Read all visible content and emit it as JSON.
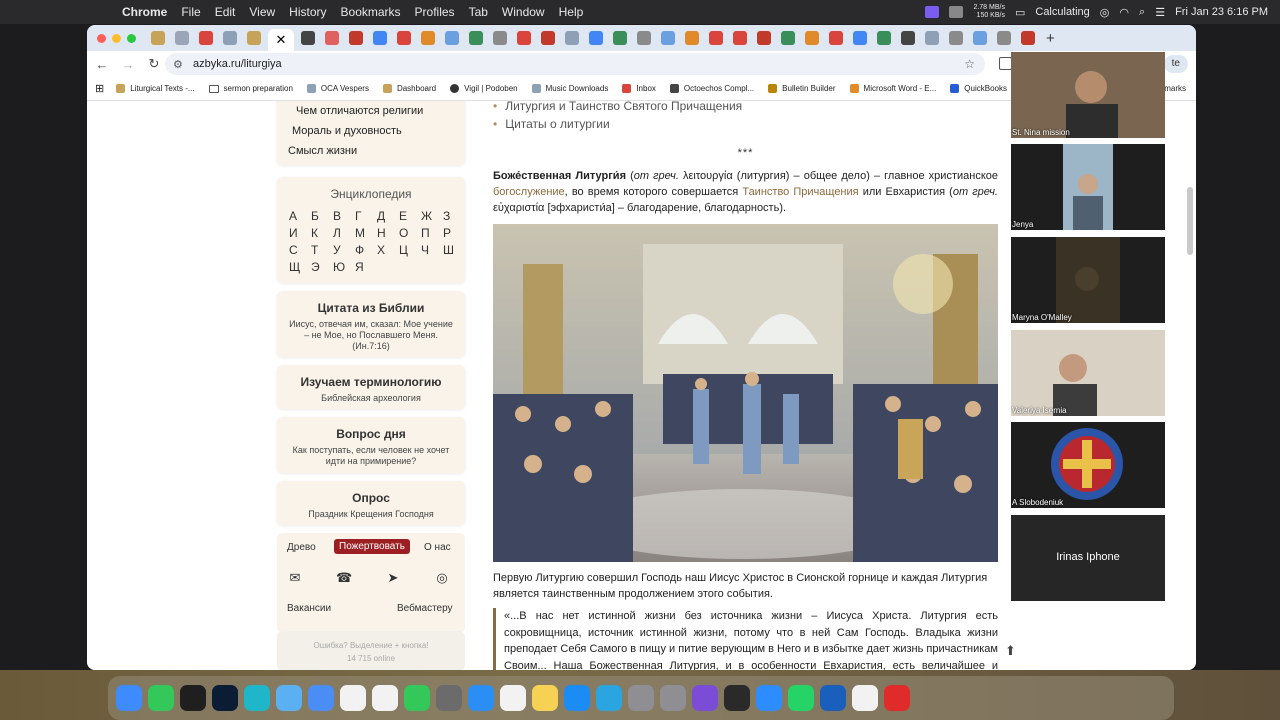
{
  "menubar": {
    "app": "Chrome",
    "items": [
      "File",
      "Edit",
      "View",
      "History",
      "Bookmarks",
      "Profiles",
      "Tab",
      "Window",
      "Help"
    ],
    "net_up": "2.78 MB/s",
    "net_down": "150 KB/s",
    "battery_status": "Calculating",
    "clock": "Fri Jan 23  6:16 PM"
  },
  "browser": {
    "url": "azbyka.ru/liturgiya",
    "profile_chip": "te",
    "bookmarks": [
      "Liturgical Texts -...",
      "sermon preparation",
      "OCA Vespers",
      "Dashboard",
      "Vigil | Podoben",
      "Music Downloads",
      "Inbox",
      "Octoechos Compl...",
      "Bulletin Builder",
      "Microsoft Word - E...",
      "QuickBooks"
    ],
    "bookmarks_right": "marks"
  },
  "sidebar": {
    "nav_links": [
      "Чем отличаются религии",
      "Мораль и духовность",
      "Смысл жизни"
    ],
    "encyclopedia": {
      "title": "Энциклопедия",
      "letters": [
        "А",
        "Б",
        "В",
        "Г",
        "Д",
        "Е",
        "Ж",
        "З",
        "И",
        "К",
        "Л",
        "М",
        "Н",
        "О",
        "П",
        "Р",
        "С",
        "Т",
        "У",
        "Ф",
        "Х",
        "Ц",
        "Ч",
        "Ш",
        "Щ",
        "Э",
        "Ю",
        "Я"
      ]
    },
    "bible_quote": {
      "title": "Цитата из Библии",
      "text": "Иисус, отвечая им, сказал: Мое учение – не Мое, но Пославшего Меня.",
      "ref": "(Ин.7:16)"
    },
    "terminology": {
      "title": "Изучаем терминологию",
      "sub": "Библейская археология"
    },
    "question": {
      "title": "Вопрос дня",
      "sub": "Как поступать, если человек не хочет идти на примирение?"
    },
    "poll": {
      "title": "Опрос",
      "sub": "Праздник Крещения Господня"
    },
    "footer": {
      "tree": "Древо",
      "donate": "Пожертвовать",
      "about": "О нас",
      "vacancies": "Вакансии",
      "webmaster": "Вебмастеру",
      "error_hint": "Ошибка? Выделение + кнопка!",
      "online": "14 715 online"
    }
  },
  "article": {
    "bullets": [
      "Литургия и Таинство Святого Причащения",
      "Цитаты о литургии"
    ],
    "separator": "***",
    "intro": {
      "term": "Боже́ственная Литурги́я",
      "p1": " (",
      "from_greek": "от греч.",
      "greek1": " λειτουργία (литургия) – общее дело) – главное христианское ",
      "link1": "богослужение",
      "p2": ", во время которого совершается ",
      "link2": "Таинство Причащения",
      "p3": " или Евхаристия (",
      "from_greek2": "от греч.",
      "greek2": " εὐχαριστία [эфхаристи́а] – благодарение, благодарность)."
    },
    "caption": "Первую Литургию совершил Господь наш Иисус Христос в Сионской горнице и каждая Литургия является таинственным продолжением этого события.",
    "quote": "«...В нас нет истинной жизни без источника жизни – Иисуса Христа. Литургия есть сокровищница, источник истинной жизни, потому что в ней Сам Господь. Владыка жизни преподает Себя Самого в пищу и питие верующим в Него и в избытке дает жизнь причастникам Своим... Наша Божественная Литургия, и в особенности Евхаристия, есть величайшее и постоянное"
  },
  "video_call": {
    "participants": [
      "St. Nina mission",
      "Jenya",
      "Maryna O'Malley",
      "Valeriya Isernia",
      "A Slobodeniuk",
      "Irinas Iphone"
    ]
  },
  "dock": {
    "apps": [
      "Finder",
      "Messages",
      "PyCharm",
      "Lr",
      "Canva",
      "Preview",
      "Mail",
      "Chrome",
      "ChatGPT",
      "FaceTime",
      "Screenshot",
      "Safari",
      "Reminders",
      "Notes",
      "App Store",
      "Telegram",
      "Settings",
      "Photo Booth",
      "Feedback",
      "Monitor",
      "zoom",
      "WhatsApp",
      "Trello",
      "Navigator",
      "Creative Cloud"
    ]
  },
  "colors": {
    "accent_brown": "#8a6a3e",
    "donate_red": "#9c1f24",
    "card_bg": "#f9f3ea",
    "tabstrip": "#dfe7f3"
  }
}
